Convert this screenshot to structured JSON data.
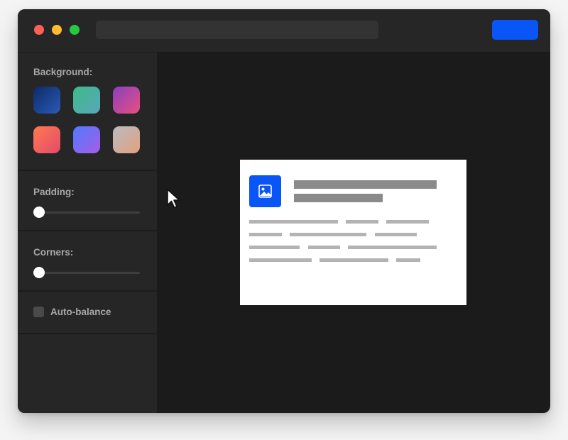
{
  "window": {
    "controls": [
      "close",
      "minimize",
      "maximize"
    ]
  },
  "toolbar": {
    "address_bar_placeholder": "",
    "export_button_label": ""
  },
  "sidebar": {
    "background": {
      "label": "Background:",
      "swatches": [
        {
          "name": "deep-blue",
          "colors": [
            "#0d2a66",
            "#2b5ab8"
          ]
        },
        {
          "name": "green-teal",
          "colors": [
            "#3dbb88",
            "#5aa6b8"
          ]
        },
        {
          "name": "purple-pink",
          "colors": [
            "#8a3fc0",
            "#e8507e"
          ]
        },
        {
          "name": "orange-red",
          "colors": [
            "#ff7a50",
            "#e24a6a"
          ]
        },
        {
          "name": "blue-purple",
          "colors": [
            "#4f7bff",
            "#a65ce8"
          ]
        },
        {
          "name": "gray-peach",
          "colors": [
            "#b9bcc2",
            "#e3a07e"
          ]
        }
      ]
    },
    "padding": {
      "label": "Padding:",
      "value": 0
    },
    "corners": {
      "label": "Corners:",
      "value": 0
    },
    "auto_balance": {
      "label": "Auto-balance",
      "checked": false
    }
  },
  "preview": {
    "image_icon": "image-icon"
  },
  "colors": {
    "accent": "#0a55f5",
    "traffic_red": "#fe5f57",
    "traffic_yellow": "#febc2e",
    "traffic_green": "#28c840"
  }
}
